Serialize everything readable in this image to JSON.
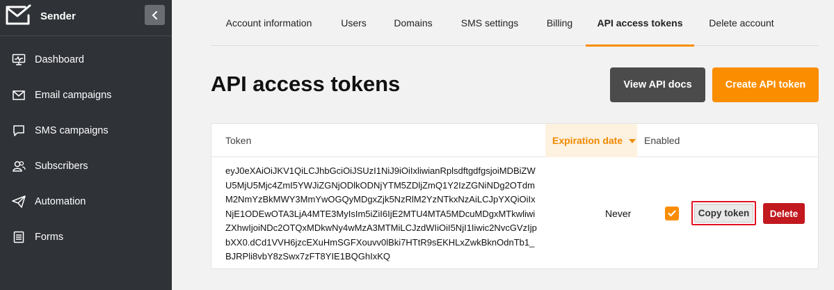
{
  "app": {
    "name": "Sender"
  },
  "sidebar": {
    "items": [
      {
        "label": "Dashboard",
        "icon": "dashboard-icon"
      },
      {
        "label": "Email campaigns",
        "icon": "envelope-icon"
      },
      {
        "label": "SMS campaigns",
        "icon": "chat-bubble-icon"
      },
      {
        "label": "Subscribers",
        "icon": "users-icon"
      },
      {
        "label": "Automation",
        "icon": "paper-plane-icon"
      },
      {
        "label": "Forms",
        "icon": "form-icon"
      }
    ]
  },
  "tabs": [
    {
      "label": "Account information",
      "active": false
    },
    {
      "label": "Users",
      "active": false
    },
    {
      "label": "Domains",
      "active": false
    },
    {
      "label": "SMS settings",
      "active": false
    },
    {
      "label": "Billing",
      "active": false
    },
    {
      "label": "API access tokens",
      "active": true
    },
    {
      "label": "Delete account",
      "active": false
    }
  ],
  "page": {
    "title": "API access tokens",
    "view_docs_label": "View API docs",
    "create_token_label": "Create API token"
  },
  "table": {
    "headers": {
      "token": "Token",
      "expiration": "Expiration date",
      "enabled": "Enabled"
    },
    "rows": [
      {
        "token": "eyJ0eXAiOiJKV1QiLCJhbGciOiJSUzI1NiJ9iOiIxliwianRplsdftgdfgsjoiMDBiZWU5MjU5Mjc4ZmI5YWJiZGNjODlkODNjYTM5ZDljZmQ1Y2IzZGNiNDg2OTdmM2NmYzBkMWY3MmYwOGQyMDgxZjk5NzRlM2YzNTkxNzAiLCJpYXQiOiIxNjE1ODEwOTA3LjA4MTE3MyIsIm5iZiI6IjE2MTU4MTA5MDcuMDgxMTkwliwiZXhwIjoiNDc2OTQxMDkwNy4wMzA3MTMiLCJzdWIiOiI5NjI1Iiwic2NvcGVzIjpbXX0.dCd1VVH6jzcEXuHmSGFXouvv0lBki7HTtR9sEKHLxZwkBknOdnTb1_BJRPli8vbY8zSwx7zFT8YIE1BQGhIxKQ",
        "expiration": "Never",
        "enabled": true,
        "copy_label": "Copy token",
        "delete_label": "Delete"
      }
    ]
  },
  "colors": {
    "accent": "#fb8d00",
    "sidebar": "#2f3237",
    "danger": "#c1191f",
    "highlight_border": "#e20f1f"
  }
}
